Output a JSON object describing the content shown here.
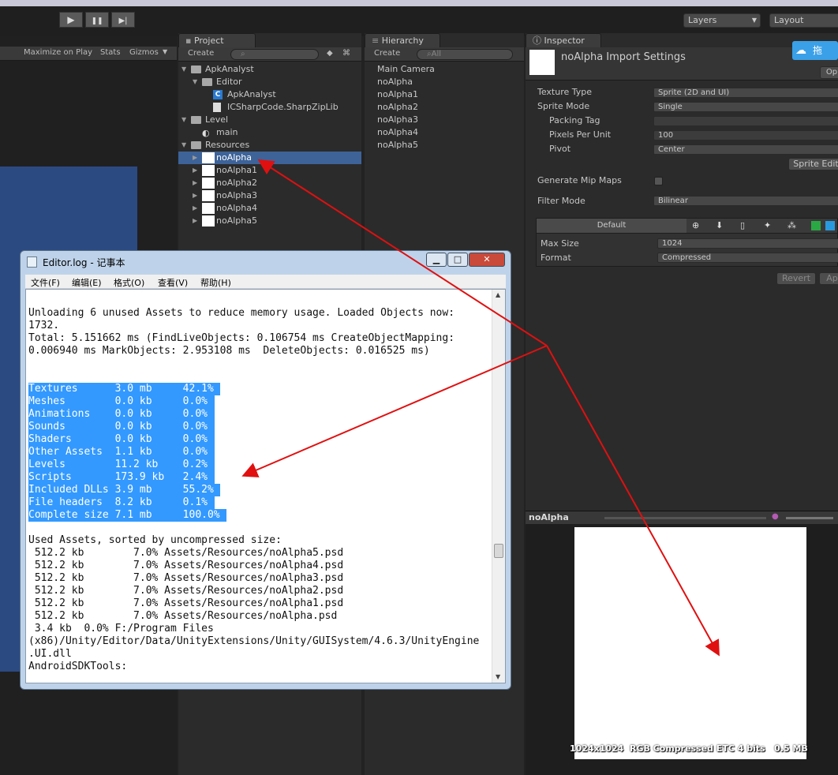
{
  "toolbar": {
    "layers_label": "Layers",
    "layout_label": "Layout",
    "play_icon": "▶",
    "pause_icon": "❚❚",
    "step_icon": "▶|"
  },
  "game_view": {
    "toolbar_items": [
      "Maximize on Play",
      "Stats",
      "Gizmos"
    ]
  },
  "project": {
    "tab_label": "Project",
    "create_label": "Create",
    "tree": [
      {
        "label": "ApkAnalyst",
        "type": "folder",
        "indent": 0
      },
      {
        "label": "Editor",
        "type": "folder",
        "indent": 1
      },
      {
        "label": "ApkAnalyst",
        "type": "script",
        "indent": 2
      },
      {
        "label": "ICSharpCode.SharpZipLib",
        "type": "file",
        "indent": 2
      },
      {
        "label": "Level",
        "type": "folder",
        "indent": 0
      },
      {
        "label": "main",
        "type": "scene",
        "indent": 1
      },
      {
        "label": "Resources",
        "type": "folder",
        "indent": 0
      },
      {
        "label": "noAlpha",
        "type": "texture",
        "indent": 1
      },
      {
        "label": "noAlpha1",
        "type": "texture",
        "indent": 1
      },
      {
        "label": "noAlpha2",
        "type": "texture",
        "indent": 1
      },
      {
        "label": "noAlpha3",
        "type": "texture",
        "indent": 1
      },
      {
        "label": "noAlpha4",
        "type": "texture",
        "indent": 1
      },
      {
        "label": "noAlpha5",
        "type": "texture",
        "indent": 1
      }
    ]
  },
  "hierarchy": {
    "tab_label": "Hierarchy",
    "create_label": "Create",
    "search_placeholder": "All",
    "items": [
      "Main Camera",
      "noAlpha",
      "noAlpha1",
      "noAlpha2",
      "noAlpha3",
      "noAlpha4",
      "noAlpha5"
    ]
  },
  "inspector": {
    "tab_label": "Inspector",
    "title": "noAlpha Import Settings",
    "open_label": "Op",
    "top_right_label": "拖",
    "rows": [
      {
        "label": "Texture Type",
        "value": "Sprite (2D and UI)"
      },
      {
        "label": "Sprite Mode",
        "value": "Single"
      },
      {
        "label": "Packing Tag",
        "value": ""
      },
      {
        "label": "Pixels Per Unit",
        "value": "100"
      },
      {
        "label": "Pivot",
        "value": "Center"
      }
    ],
    "sprite_editor_label": "Sprite Edit",
    "mip_label": "Generate Mip Maps",
    "filter_label": "Filter Mode",
    "filter_value": "Bilinear",
    "platform_default": "Default",
    "max_size_label": "Max Size",
    "max_size_value": "1024",
    "format_label": "Format",
    "format_value": "Compressed",
    "revert_label": "Revert",
    "apply_label": "App"
  },
  "preview": {
    "name": "noAlpha",
    "info": "1024x1024  RGB Compressed ETC 4 bits   0.5 MB"
  },
  "notepad": {
    "title": "Editor.log - 记事本",
    "menu": [
      "文件(F)",
      "编辑(E)",
      "格式(O)",
      "查看(V)",
      "帮助(H)"
    ],
    "min_icon": "▁",
    "max_icon": "□",
    "close_icon": "✕",
    "lines_top": [
      "Unloading 6 unused Assets to reduce memory usage. Loaded Objects now:",
      "1732.",
      "Total: 5.151662 ms (FindLiveObjects: 0.106754 ms CreateObjectMapping:",
      "0.006940 ms MarkObjects: 2.953108 ms  DeleteObjects: 0.016525 ms)"
    ],
    "selected_lines": [
      "Textures      3.0 mb     42.1% ",
      "Meshes        0.0 kb     0.0% ",
      "Animations    0.0 kb     0.0% ",
      "Sounds        0.0 kb     0.0% ",
      "Shaders       0.0 kb     0.0% ",
      "Other Assets  1.1 kb     0.0% ",
      "Levels        11.2 kb    0.2% ",
      "Scripts       173.9 kb   2.4% ",
      "Included DLLs 3.9 mb     55.2% ",
      "File headers  8.2 kb     0.1% ",
      "Complete size 7.1 mb     100.0% "
    ],
    "lines_bottom": [
      "Used Assets, sorted by uncompressed size:",
      " 512.2 kb        7.0% Assets/Resources/noAlpha5.psd",
      " 512.2 kb        7.0% Assets/Resources/noAlpha4.psd",
      " 512.2 kb        7.0% Assets/Resources/noAlpha3.psd",
      " 512.2 kb        7.0% Assets/Resources/noAlpha2.psd",
      " 512.2 kb        7.0% Assets/Resources/noAlpha1.psd",
      " 512.2 kb        7.0% Assets/Resources/noAlpha.psd",
      " 3.4 kb  0.0% F:/Program Files",
      "(x86)/Unity/Editor/Data/UnityExtensions/Unity/GUISystem/4.6.3/UnityEngine",
      ".UI.dll",
      "AndroidSDKTools:"
    ]
  },
  "colors": {
    "selection": "#3399ff",
    "project_selected": "#3d6399",
    "arrow": "#e01010",
    "game_blue": "#2c4a82"
  }
}
